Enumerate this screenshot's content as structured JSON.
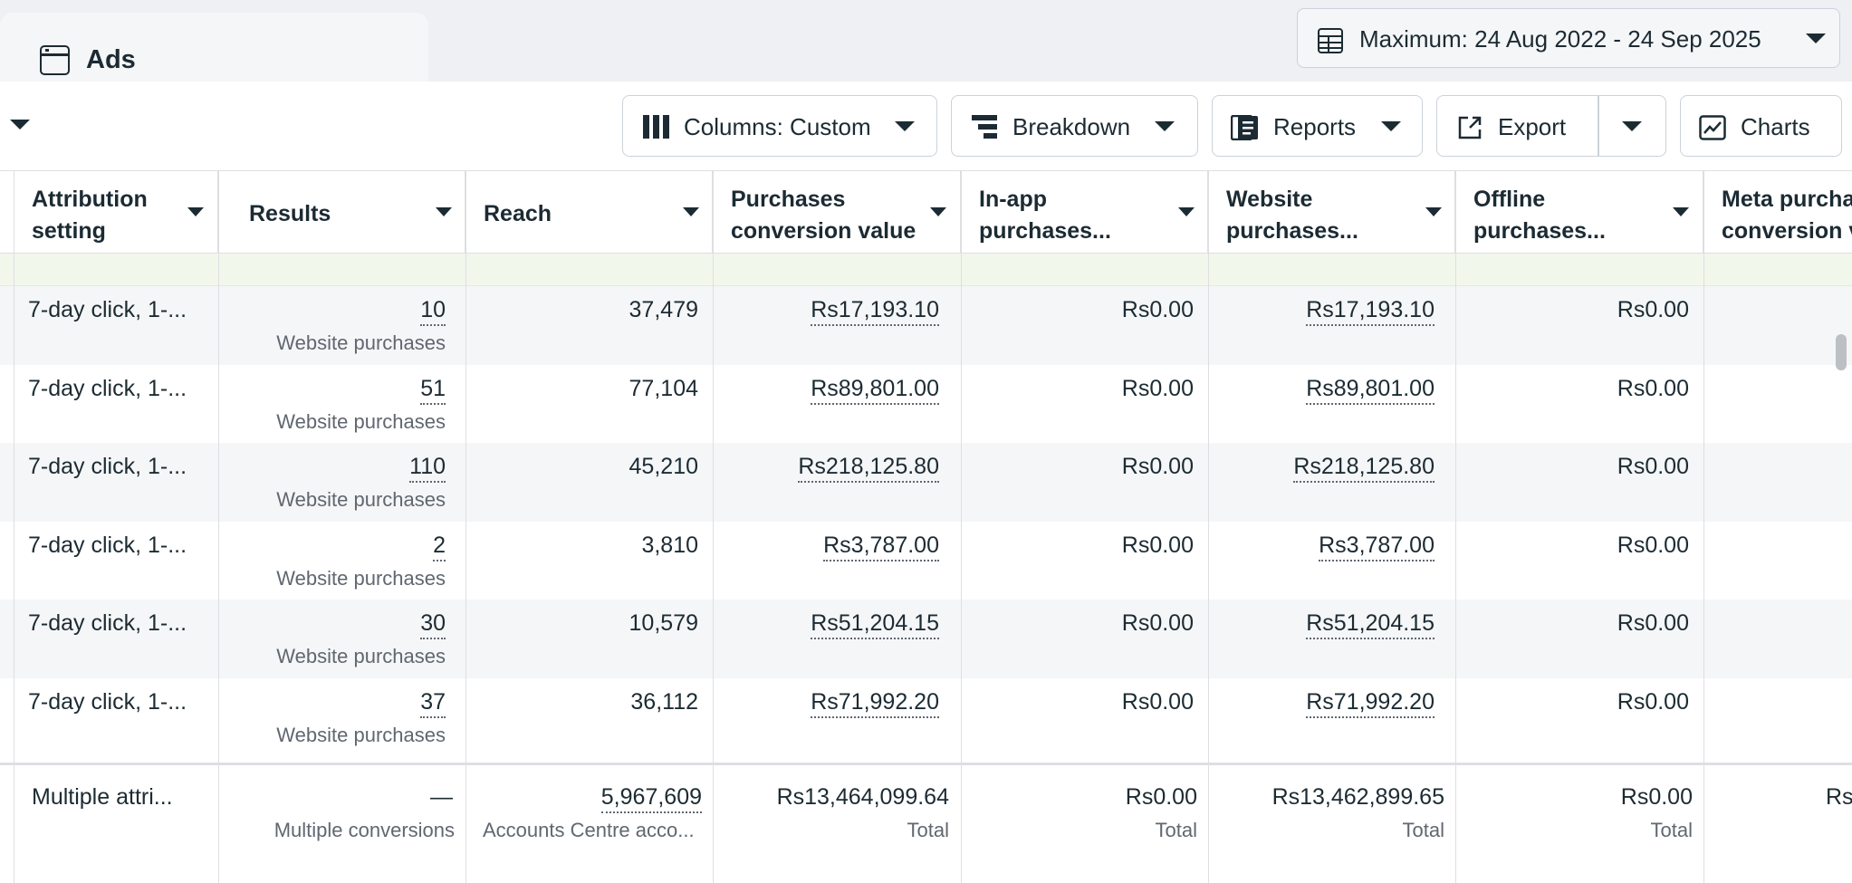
{
  "tab": {
    "label": "Ads",
    "icon": "browser-window-icon"
  },
  "date_range": {
    "label": "Maximum: 24 Aug 2022 - 24 Sep 2025",
    "icon": "calendar-table-icon"
  },
  "toolbar": {
    "columns_label": "Columns: Custom",
    "breakdown_label": "Breakdown",
    "reports_label": "Reports",
    "export_label": "Export",
    "charts_label": "Charts"
  },
  "columns": [
    "Attribution\nsetting",
    "Results",
    "Reach",
    "Purchases\nconversion value",
    "In-app\npurchases...",
    "Website\npurchases...",
    "Offline\npurchases...",
    "Meta purcha\nconversion v"
  ],
  "rows": [
    {
      "attribution": "7-day click, 1-...",
      "results": "10",
      "results_sub": "Website purchases",
      "reach": "37,479",
      "purchases_value": "Rs17,193.10",
      "inapp": "Rs0.00",
      "website": "Rs17,193.10",
      "offline": "Rs0.00"
    },
    {
      "attribution": "7-day click, 1-...",
      "results": "51",
      "results_sub": "Website purchases",
      "reach": "77,104",
      "purchases_value": "Rs89,801.00",
      "inapp": "Rs0.00",
      "website": "Rs89,801.00",
      "offline": "Rs0.00"
    },
    {
      "attribution": "7-day click, 1-...",
      "results": "110",
      "results_sub": "Website purchases",
      "reach": "45,210",
      "purchases_value": "Rs218,125.80",
      "inapp": "Rs0.00",
      "website": "Rs218,125.80",
      "offline": "Rs0.00"
    },
    {
      "attribution": "7-day click, 1-...",
      "results": "2",
      "results_sub": "Website purchases",
      "reach": "3,810",
      "purchases_value": "Rs3,787.00",
      "inapp": "Rs0.00",
      "website": "Rs3,787.00",
      "offline": "Rs0.00"
    },
    {
      "attribution": "7-day click, 1-...",
      "results": "30",
      "results_sub": "Website purchases",
      "reach": "10,579",
      "purchases_value": "Rs51,204.15",
      "inapp": "Rs0.00",
      "website": "Rs51,204.15",
      "offline": "Rs0.00"
    },
    {
      "attribution": "7-day click, 1-...",
      "results": "37",
      "results_sub": "Website purchases",
      "reach": "36,112",
      "purchases_value": "Rs71,992.20",
      "inapp": "Rs0.00",
      "website": "Rs71,992.20",
      "offline": "Rs0.00"
    }
  ],
  "totals": {
    "attribution": "Multiple attri...",
    "results": "—",
    "results_sub": "Multiple conversions",
    "reach": "5,967,609",
    "reach_sub": "Accounts Centre acco...",
    "purchases_value": "Rs13,464,099.64",
    "purchases_value_sub": "Total",
    "inapp": "Rs0.00",
    "inapp_sub": "Total",
    "website": "Rs13,462,899.65",
    "website_sub": "Total",
    "offline": "Rs0.00",
    "offline_sub": "Total",
    "meta": "Rs"
  }
}
